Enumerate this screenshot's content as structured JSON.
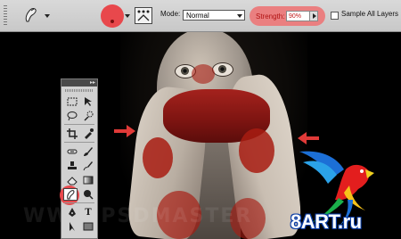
{
  "options_bar": {
    "tool_icon": "smudge-tool-icon",
    "brush_preset_icon": "brush-preset-picker-icon",
    "brush_panel_icon": "brush-panel-toggle-icon",
    "mode_label": "Mode:",
    "mode_value": "Normal",
    "strength_label": "Strength:",
    "strength_value": "90%",
    "sample_all_layers_label": "Sample All Layers",
    "sample_all_layers_checked": false
  },
  "tools_panel": {
    "collapse_glyph": "▸▸",
    "close_glyph": "x",
    "tools": [
      "rectangular-marquee-tool",
      "move-tool",
      "lasso-tool",
      "quick-selection-tool",
      "crop-tool",
      "eyedropper-tool",
      "spot-healing-brush-tool",
      "brush-tool",
      "clone-stamp-tool",
      "history-brush-tool",
      "eraser-tool",
      "gradient-tool",
      "smudge-tool",
      "dodge-tool",
      "pen-tool",
      "type-tool",
      "path-selection-tool",
      "rectangle-tool"
    ],
    "type_glyph": "T",
    "highlighted_tool": "smudge-tool"
  },
  "photo": {
    "watermark_text": "WWW.PSDMASTER",
    "brand_text": "8ART.ru",
    "highlight_color": "#e8484c",
    "arrow_color": "#e03a38"
  }
}
